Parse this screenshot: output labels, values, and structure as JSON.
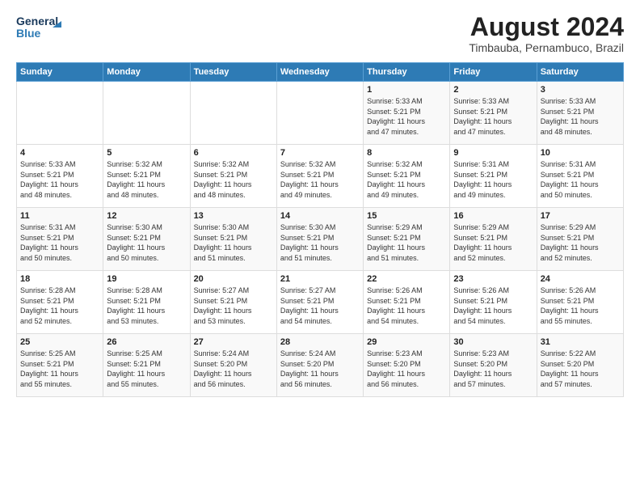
{
  "logo": {
    "line1": "General",
    "line2": "Blue"
  },
  "title": "August 2024",
  "subtitle": "Timbauba, Pernambuco, Brazil",
  "days_of_week": [
    "Sunday",
    "Monday",
    "Tuesday",
    "Wednesday",
    "Thursday",
    "Friday",
    "Saturday"
  ],
  "weeks": [
    [
      {
        "day": "",
        "info": ""
      },
      {
        "day": "",
        "info": ""
      },
      {
        "day": "",
        "info": ""
      },
      {
        "day": "",
        "info": ""
      },
      {
        "day": "1",
        "info": "Sunrise: 5:33 AM\nSunset: 5:21 PM\nDaylight: 11 hours\nand 47 minutes."
      },
      {
        "day": "2",
        "info": "Sunrise: 5:33 AM\nSunset: 5:21 PM\nDaylight: 11 hours\nand 47 minutes."
      },
      {
        "day": "3",
        "info": "Sunrise: 5:33 AM\nSunset: 5:21 PM\nDaylight: 11 hours\nand 48 minutes."
      }
    ],
    [
      {
        "day": "4",
        "info": "Sunrise: 5:33 AM\nSunset: 5:21 PM\nDaylight: 11 hours\nand 48 minutes."
      },
      {
        "day": "5",
        "info": "Sunrise: 5:32 AM\nSunset: 5:21 PM\nDaylight: 11 hours\nand 48 minutes."
      },
      {
        "day": "6",
        "info": "Sunrise: 5:32 AM\nSunset: 5:21 PM\nDaylight: 11 hours\nand 48 minutes."
      },
      {
        "day": "7",
        "info": "Sunrise: 5:32 AM\nSunset: 5:21 PM\nDaylight: 11 hours\nand 49 minutes."
      },
      {
        "day": "8",
        "info": "Sunrise: 5:32 AM\nSunset: 5:21 PM\nDaylight: 11 hours\nand 49 minutes."
      },
      {
        "day": "9",
        "info": "Sunrise: 5:31 AM\nSunset: 5:21 PM\nDaylight: 11 hours\nand 49 minutes."
      },
      {
        "day": "10",
        "info": "Sunrise: 5:31 AM\nSunset: 5:21 PM\nDaylight: 11 hours\nand 50 minutes."
      }
    ],
    [
      {
        "day": "11",
        "info": "Sunrise: 5:31 AM\nSunset: 5:21 PM\nDaylight: 11 hours\nand 50 minutes."
      },
      {
        "day": "12",
        "info": "Sunrise: 5:30 AM\nSunset: 5:21 PM\nDaylight: 11 hours\nand 50 minutes."
      },
      {
        "day": "13",
        "info": "Sunrise: 5:30 AM\nSunset: 5:21 PM\nDaylight: 11 hours\nand 51 minutes."
      },
      {
        "day": "14",
        "info": "Sunrise: 5:30 AM\nSunset: 5:21 PM\nDaylight: 11 hours\nand 51 minutes."
      },
      {
        "day": "15",
        "info": "Sunrise: 5:29 AM\nSunset: 5:21 PM\nDaylight: 11 hours\nand 51 minutes."
      },
      {
        "day": "16",
        "info": "Sunrise: 5:29 AM\nSunset: 5:21 PM\nDaylight: 11 hours\nand 52 minutes."
      },
      {
        "day": "17",
        "info": "Sunrise: 5:29 AM\nSunset: 5:21 PM\nDaylight: 11 hours\nand 52 minutes."
      }
    ],
    [
      {
        "day": "18",
        "info": "Sunrise: 5:28 AM\nSunset: 5:21 PM\nDaylight: 11 hours\nand 52 minutes."
      },
      {
        "day": "19",
        "info": "Sunrise: 5:28 AM\nSunset: 5:21 PM\nDaylight: 11 hours\nand 53 minutes."
      },
      {
        "day": "20",
        "info": "Sunrise: 5:27 AM\nSunset: 5:21 PM\nDaylight: 11 hours\nand 53 minutes."
      },
      {
        "day": "21",
        "info": "Sunrise: 5:27 AM\nSunset: 5:21 PM\nDaylight: 11 hours\nand 54 minutes."
      },
      {
        "day": "22",
        "info": "Sunrise: 5:26 AM\nSunset: 5:21 PM\nDaylight: 11 hours\nand 54 minutes."
      },
      {
        "day": "23",
        "info": "Sunrise: 5:26 AM\nSunset: 5:21 PM\nDaylight: 11 hours\nand 54 minutes."
      },
      {
        "day": "24",
        "info": "Sunrise: 5:26 AM\nSunset: 5:21 PM\nDaylight: 11 hours\nand 55 minutes."
      }
    ],
    [
      {
        "day": "25",
        "info": "Sunrise: 5:25 AM\nSunset: 5:21 PM\nDaylight: 11 hours\nand 55 minutes."
      },
      {
        "day": "26",
        "info": "Sunrise: 5:25 AM\nSunset: 5:21 PM\nDaylight: 11 hours\nand 55 minutes."
      },
      {
        "day": "27",
        "info": "Sunrise: 5:24 AM\nSunset: 5:20 PM\nDaylight: 11 hours\nand 56 minutes."
      },
      {
        "day": "28",
        "info": "Sunrise: 5:24 AM\nSunset: 5:20 PM\nDaylight: 11 hours\nand 56 minutes."
      },
      {
        "day": "29",
        "info": "Sunrise: 5:23 AM\nSunset: 5:20 PM\nDaylight: 11 hours\nand 56 minutes."
      },
      {
        "day": "30",
        "info": "Sunrise: 5:23 AM\nSunset: 5:20 PM\nDaylight: 11 hours\nand 57 minutes."
      },
      {
        "day": "31",
        "info": "Sunrise: 5:22 AM\nSunset: 5:20 PM\nDaylight: 11 hours\nand 57 minutes."
      }
    ]
  ]
}
